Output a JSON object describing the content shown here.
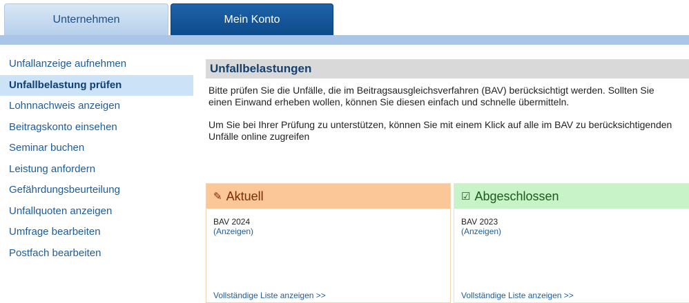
{
  "tabs": {
    "unternehmen": "Unternehmen",
    "mein_konto": "Mein Konto"
  },
  "sidebar": {
    "items": [
      {
        "label": "Unfallanzeige  aufnehmen"
      },
      {
        "label": "Unfallbelastung prüfen",
        "active": true
      },
      {
        "label": "Lohnnachweis anzeigen"
      },
      {
        "label": "Beitragskonto einsehen"
      },
      {
        "label": "Seminar buchen"
      },
      {
        "label": "Leistung anfordern"
      },
      {
        "label": "Gefährdungsbeurteilung"
      },
      {
        "label": "Unfallquoten  anzeigen"
      },
      {
        "label": "Umfrage bearbeiten"
      },
      {
        "label": "Postfach bearbeiten"
      }
    ]
  },
  "main": {
    "title": "Unfallbelastungen",
    "paragraph1": "Bitte prüfen Sie die Unfälle,  die im Beitragsausgleichsverfahren  (BAV) berücksichtigt werden. Sollten Sie einen Einwand erheben wollen,  können Sie diesen einfach und schnelle übermitteln.",
    "paragraph2": "Um Sie bei Ihrer  Prüfung zu unterstützen,  können Sie mit einem Klick auf alle im BAV zu berücksichtigenden  Unfälle online zugreifen"
  },
  "cards": {
    "aktuell": {
      "icon": "pencil-icon",
      "icon_glyph": "✎",
      "title": "Aktuell",
      "year": "BAV 2024",
      "link": "(Anzeigen)",
      "footer": "Vollständige Liste anzeigen  >>"
    },
    "abgeschlossen": {
      "icon": "checkbox-icon",
      "icon_glyph": "☑",
      "title": "Abgeschlossen",
      "year": "BAV 2023",
      "link": "(Anzeigen)",
      "footer": "Vollständige Liste anzeigen  >>"
    }
  }
}
